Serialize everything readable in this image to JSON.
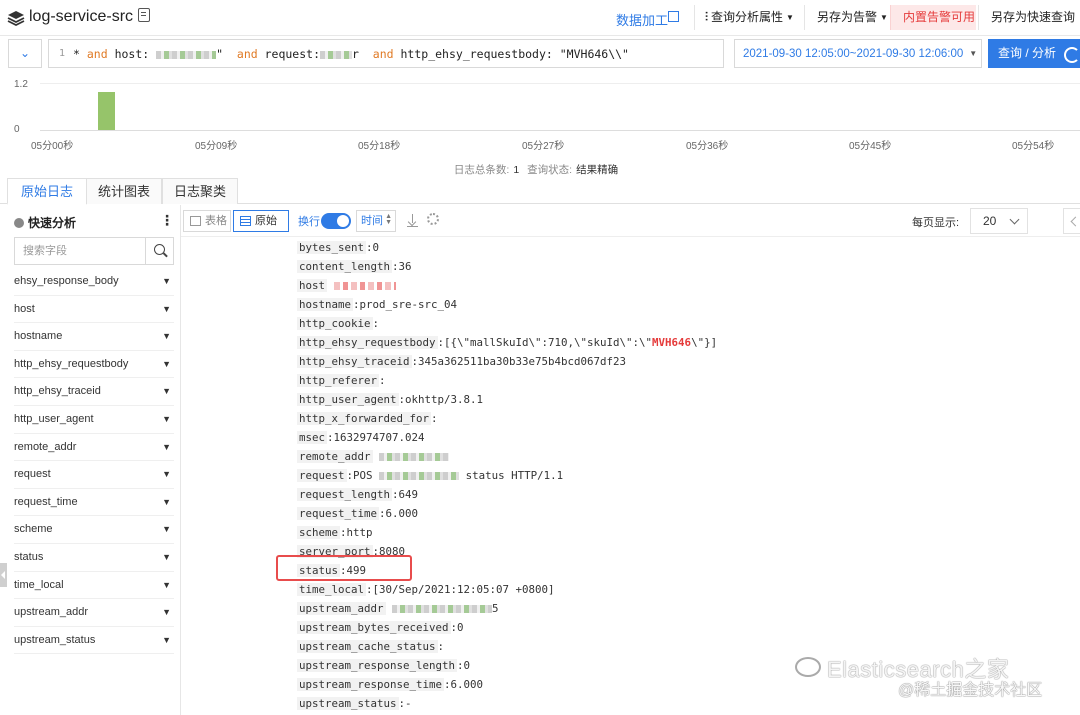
{
  "header": {
    "title": "log-service-src",
    "data_processing": "数据加工",
    "query_attr": "查询分析属性",
    "save_alert": "另存为告警",
    "builtin_alert": "内置告警可用",
    "save_quick_query": "另存为快速查询"
  },
  "query": {
    "line_number": "1",
    "parts": [
      {
        "text": "* ",
        "kw": false
      },
      {
        "text": "and",
        "kw": true
      },
      {
        "text": " host: ",
        "kw": false
      },
      {
        "text": "\"",
        "kw": false
      },
      {
        "text": "and",
        "kw": true
      },
      {
        "text": " request:",
        "kw": false
      },
      {
        "text": "r ",
        "kw": false
      },
      {
        "text": "and",
        "kw": true
      },
      {
        "text": " http_ehsy_requestbody: ",
        "kw": false
      },
      {
        "text": "\"MVH646\\\\\"",
        "kw": false
      }
    ],
    "time_range": "2021-09-30 12:05:00~2021-09-30 12:06:00",
    "submit": "查询 / 分析"
  },
  "histogram": {
    "y_ticks": [
      "1.2",
      "0"
    ],
    "x_ticks": [
      "05分00秒",
      "05分09秒",
      "05分18秒",
      "05分27秒",
      "05分36秒",
      "05分45秒",
      "05分54秒"
    ],
    "bar_color": "#96c46a"
  },
  "summary": {
    "total_label": "日志总条数:",
    "total_value": "1",
    "status_label": "查询状态:",
    "status_value": "结果精确"
  },
  "tabs": [
    {
      "label": "原始日志",
      "active": true
    },
    {
      "label": "统计图表",
      "active": false
    },
    {
      "label": "日志聚类",
      "active": false
    }
  ],
  "sidebar": {
    "title": "快速分析",
    "search_placeholder": "搜索字段",
    "fields": [
      "ehsy_response_body",
      "host",
      "hostname",
      "http_ehsy_requestbody",
      "http_ehsy_traceid",
      "http_user_agent",
      "remote_addr",
      "request",
      "request_time",
      "scheme",
      "status",
      "time_local",
      "upstream_addr",
      "upstream_status"
    ]
  },
  "toolbar": {
    "table_view": "表格",
    "raw_view": "原始",
    "wrap": "换行",
    "time_sort": "时间",
    "per_page_label": "每页显示:",
    "per_page_value": "20"
  },
  "log": {
    "entries": [
      {
        "key": "bytes_sent",
        "value": "0"
      },
      {
        "key": "content_length",
        "value": "36"
      },
      {
        "key": "host",
        "value": ""
      },
      {
        "key": "hostname",
        "value": "prod_sre-src_04"
      },
      {
        "key": "http_cookie",
        "value": ""
      },
      {
        "key": "http_ehsy_requestbody",
        "value": "[{\\\"mallSkuId\\\":710,\\\"skuId\\\":\\\"",
        "highlight": "MVH646",
        "value_after": "\\\"}]"
      },
      {
        "key": "http_ehsy_traceid",
        "value": "345a362511ba30b33e75b4bcd067df23"
      },
      {
        "key": "http_referer",
        "value": ""
      },
      {
        "key": "http_user_agent",
        "value": "okhttp/3.8.1"
      },
      {
        "key": "http_x_forwarded_for",
        "value": ""
      },
      {
        "key": "msec",
        "value": "1632974707.024"
      },
      {
        "key": "remote_addr",
        "value": ""
      },
      {
        "key": "request",
        "value": "POS",
        "value_after": "status HTTP/1.1"
      },
      {
        "key": "request_length",
        "value": "649"
      },
      {
        "key": "request_time",
        "value": "6.000"
      },
      {
        "key": "scheme",
        "value": "http"
      },
      {
        "key": "server_port",
        "value": "8080"
      },
      {
        "key": "status",
        "value": "499"
      },
      {
        "key": "time_local",
        "value": "[30/Sep/2021:12:05:07 +0800]"
      },
      {
        "key": "upstream_addr",
        "value": "",
        "value_after": "5"
      },
      {
        "key": "upstream_bytes_received",
        "value": "0"
      },
      {
        "key": "upstream_cache_status",
        "value": ""
      },
      {
        "key": "upstream_response_length",
        "value": "0"
      },
      {
        "key": "upstream_response_time",
        "value": "6.000"
      },
      {
        "key": "upstream_status",
        "value": "-"
      }
    ]
  },
  "watermark": {
    "line1": "Elasticsearch之家",
    "line2": "@稀土掘金技术社区"
  },
  "colors": {
    "accent": "#2f7be5",
    "alert_bg": "#fde8e8",
    "alert_text": "#e53b3b",
    "highlight": "#e53b3b"
  }
}
